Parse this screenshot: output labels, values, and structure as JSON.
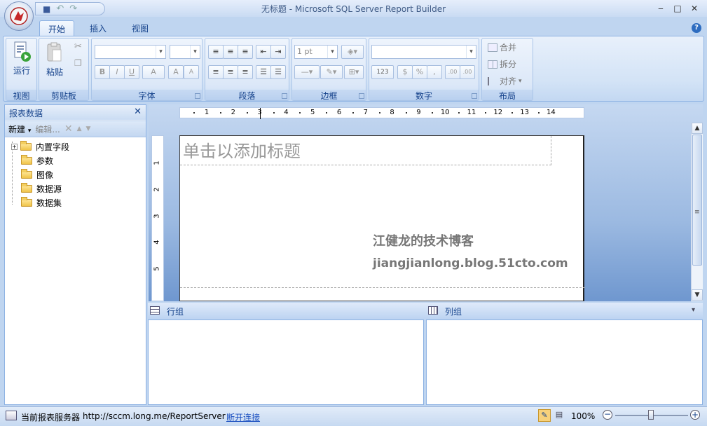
{
  "window": {
    "title": "无标题 - Microsoft SQL Server Report Builder",
    "minimize": "‒",
    "maximize": "□",
    "close": "✕"
  },
  "qat": {
    "save": "💾",
    "undo": "↶",
    "redo": "↷"
  },
  "tabs": [
    "开始",
    "插入",
    "视图"
  ],
  "ribbon": {
    "groups": {
      "view": {
        "label": "视图",
        "run": "运行"
      },
      "clipboard": {
        "label": "剪贴板",
        "paste": "粘贴"
      },
      "font": {
        "label": "字体",
        "bold": "B",
        "italic": "I",
        "underline": "U",
        "color": "A",
        "grow": "A",
        "shrink": "A"
      },
      "paragraph": {
        "label": "段落"
      },
      "border": {
        "label": "边框",
        "width": "1 pt"
      },
      "number": {
        "label": "数字",
        "placeholders": "123",
        "currency": "$",
        "percent": "%",
        "comma": ",",
        "inc": ".00",
        "dec": ".00"
      },
      "layout": {
        "label": "布局",
        "merge": "合并",
        "split": "拆分",
        "align": "对齐"
      }
    }
  },
  "left_pane": {
    "title": "报表数据",
    "new": "新建",
    "edit": "编辑...",
    "items": [
      "内置字段",
      "参数",
      "图像",
      "数据源",
      "数据集"
    ]
  },
  "ruler": {
    "h_numbers": [
      "1",
      "2",
      "3",
      "4",
      "5",
      "6",
      "7",
      "8",
      "9",
      "10",
      "11",
      "12",
      "13",
      "14"
    ],
    "v_numbers": [
      "1",
      "2",
      "3",
      "4",
      "5"
    ]
  },
  "report": {
    "title_placeholder": "单击以添加标题",
    "watermark_cn": "江健龙的技术博客",
    "watermark_url": "jiangjianlong.blog.51cto.com"
  },
  "groups_pane": {
    "row": "行组",
    "col": "列组"
  },
  "status": {
    "server_label": "当前报表服务器",
    "server_url": "http://sccm.long.me/ReportServer",
    "disconnect": "断开连接",
    "zoom": "100%"
  }
}
